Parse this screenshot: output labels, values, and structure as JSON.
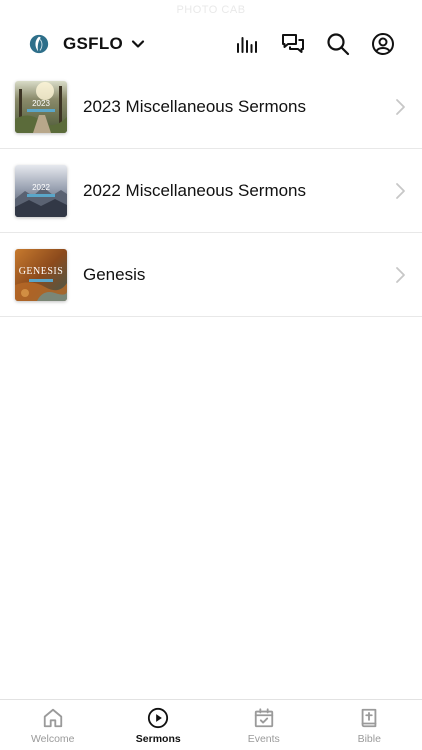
{
  "status_bar": {
    "text": "PHOTO CAB"
  },
  "header": {
    "brand_name": "GSFLO",
    "brand_logo": "leaf-logo",
    "dropdown_icon": "chevron-down-icon",
    "icons": [
      "audio-bars-icon",
      "chat-bubbles-icon",
      "search-icon",
      "profile-icon"
    ]
  },
  "sermons": [
    {
      "title": "2023 Miscellaneous Sermons",
      "thumb_text": "2023",
      "thumb_theme": "forest"
    },
    {
      "title": "2022 Miscellaneous Sermons",
      "thumb_text": "2022",
      "thumb_theme": "mountains"
    },
    {
      "title": "Genesis",
      "thumb_text": "GENESIS",
      "thumb_theme": "autumn"
    }
  ],
  "tabbar": {
    "tabs": [
      {
        "label": "Welcome",
        "icon": "home-icon",
        "active": false
      },
      {
        "label": "Sermons",
        "icon": "play-circle-icon",
        "active": true
      },
      {
        "label": "Events",
        "icon": "calendar-check-icon",
        "active": false
      },
      {
        "label": "Bible",
        "icon": "bible-icon",
        "active": false
      }
    ]
  },
  "colors": {
    "accent_logo": "#2e6f8a",
    "active_tab": "#111111",
    "inactive_tab": "#9a9a9a"
  }
}
